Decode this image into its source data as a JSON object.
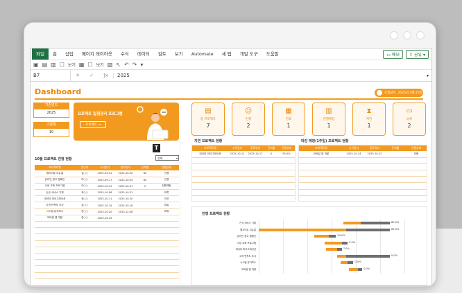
{
  "ribbon": {
    "tabs": [
      "파일",
      "홈",
      "삽입",
      "페이지 레이아웃",
      "수식",
      "데이터",
      "검토",
      "보기",
      "Automate",
      "세 탭",
      "개발 도구",
      "도움말"
    ],
    "memo": "메모",
    "share": "공유"
  },
  "qat": {
    "check1": "보기",
    "check2": "보기"
  },
  "formula": {
    "cell": "B7",
    "value": "2025"
  },
  "dashboard": {
    "title": "Dashboard",
    "user": "오팔냥이",
    "user_info": "2025년 4월 25일",
    "kpi": [
      {
        "label": "기준연도",
        "value": "2025"
      },
      {
        "label": "기준월",
        "value": "10"
      }
    ],
    "banner_title": "프로젝트 일정관리 프로그램",
    "banner_button": "프로젝트 →",
    "select_value": "전체"
  },
  "cards": [
    {
      "label": "총 프로젝트",
      "value": "7"
    },
    {
      "label": "진행",
      "value": "2"
    },
    {
      "label": "완료",
      "value": "1"
    },
    {
      "label": "진행예정",
      "value": "1"
    },
    {
      "label": "지연",
      "value": "1"
    },
    {
      "label": "보류",
      "value": "2"
    }
  ],
  "main_table": {
    "title": "10월 프로젝트 진행 현황",
    "columns": [
      "프로젝트명",
      "담당자",
      "시작일자",
      "종료일자",
      "진척률",
      "진행상태"
    ],
    "rows": [
      [
        "웹사이트 리뉴얼",
        "김○○",
        "2025-09-01",
        "2025-10-30",
        "80",
        "진행"
      ],
      [
        "온라인 광고 캠페인",
        "박○○",
        "2025-09-17",
        "2025-10-05",
        "80",
        "진행"
      ],
      [
        "사내 교육 프로그램",
        "이○○",
        "2025-10-01",
        "2025-10-31",
        "5",
        "진행예정"
      ],
      [
        "신규 서비스 기획",
        "최○○",
        "2025-10-08",
        "2025-10-31",
        "",
        "보류"
      ],
      [
        "데이터 마이그레이션",
        "정○○",
        "2025-10-11",
        "2025-10-20",
        "",
        "지연"
      ],
      [
        "고객 만족도 조사",
        "강○○",
        "2025-10-14",
        "2025-10-18",
        "",
        "완료"
      ],
      [
        "시스템 유지보수",
        "윤○○",
        "2025-10-20",
        "2025-12-08",
        "",
        "보류"
      ],
      [
        "모바일 앱 개발",
        "한○○",
        "2025-10-25",
        "",
        "",
        ""
      ]
    ]
  },
  "delay_table": {
    "title": "지연 프로젝트 현황",
    "columns": [
      "프로젝트명",
      "시작일자",
      "종료일자",
      "진척률",
      "진행상태"
    ],
    "rows": [
      [
        "데이터 마이그레이션",
        "2025-10-11",
        "2025-10-17",
        "0",
        "55.5%"
      ]
    ]
  },
  "upcoming_table": {
    "title": "마감 예정(1주일) 프로젝트 현황",
    "columns": [
      "프로젝트명",
      "시작일자",
      "종료일자",
      "진척률",
      "진행상태"
    ],
    "rows": [
      [
        "모바일 앱 개발",
        "2025-10-14",
        "2025-10-22",
        "",
        "진행"
      ]
    ]
  },
  "chart_data": {
    "type": "bar",
    "title": "진행 프로젝트 현황",
    "categories": [
      "신규 서비스 기획",
      "웹사이트 리뉴얼",
      "온라인 광고 캠페인",
      "사내 교육 프로그램",
      "데이터 마이그레이션",
      "고객 만족도 조사",
      "시스템 유지보수",
      "모바일 앱 개발"
    ],
    "value_labels": [
      "80.0%",
      "80.0%",
      "20.0%",
      "5.0%",
      "7.0%",
      "0.0%",
      "0.0%",
      "0.0%"
    ],
    "orange_start": [
      0.58,
      0.0,
      0.38,
      0.45,
      0.46,
      0.54,
      0.56,
      0.62
    ],
    "orange_len": [
      0.12,
      0.6,
      0.1,
      0.12,
      0.08,
      0.06,
      0.05,
      0.06
    ],
    "gray_len": [
      0.2,
      0.3,
      0.05,
      0.04,
      0.03,
      0.3,
      0.04,
      0.03
    ]
  }
}
